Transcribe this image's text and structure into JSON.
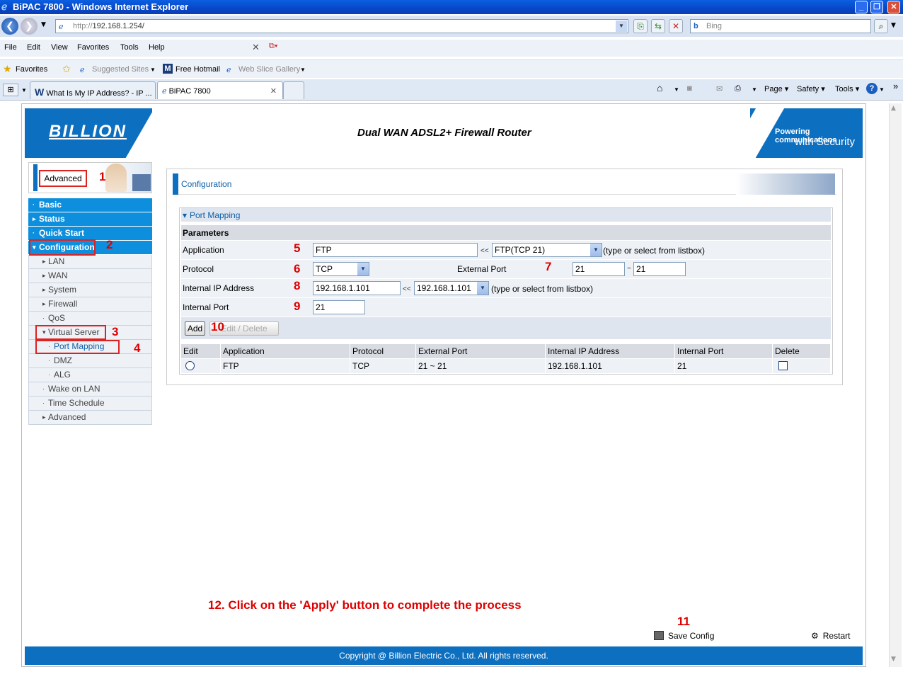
{
  "window": {
    "title": "BiPAC 7800 - Windows Internet Explorer"
  },
  "address": {
    "protocol": "http://",
    "host": "192.168.1.254/",
    "search_placeholder": "Bing"
  },
  "menubar": [
    "File",
    "Edit",
    "View",
    "Favorites",
    "Tools",
    "Help"
  ],
  "favbar": {
    "favorites": "Favorites",
    "suggested": "Suggested Sites",
    "hotmail": "Free Hotmail",
    "webslice": "Web Slice Gallery"
  },
  "tabs": [
    {
      "label": "What Is My IP Address? - IP ..."
    },
    {
      "label": "BiPAC 7800"
    }
  ],
  "commandbar": {
    "page": "Page",
    "safety": "Safety",
    "tools": "Tools"
  },
  "header": {
    "logo": "BILLION",
    "product": "Dual WAN ADSL2+ Firewall Router",
    "tagline1": "Powering communications",
    "tagline2": "with Security"
  },
  "sidebar": {
    "mode": "Advanced",
    "items": [
      {
        "label": "Basic",
        "marker": "·"
      },
      {
        "label": "Status",
        "marker": "▸"
      },
      {
        "label": "Quick Start",
        "marker": "·"
      },
      {
        "label": "Configuration",
        "marker": "▾"
      },
      {
        "label": "LAN",
        "marker": "▸"
      },
      {
        "label": "WAN",
        "marker": "▸"
      },
      {
        "label": "System",
        "marker": "▸"
      },
      {
        "label": "Firewall",
        "marker": "▸"
      },
      {
        "label": "QoS",
        "marker": "·"
      },
      {
        "label": "Virtual Server",
        "marker": "▾"
      },
      {
        "label": "Port Mapping",
        "marker": "·"
      },
      {
        "label": "DMZ",
        "marker": "·"
      },
      {
        "label": "ALG",
        "marker": "·"
      },
      {
        "label": "Wake on LAN",
        "marker": "·"
      },
      {
        "label": "Time Schedule",
        "marker": "·"
      },
      {
        "label": "Advanced",
        "marker": "▸"
      }
    ]
  },
  "main": {
    "title": "Configuration",
    "section": "Port Mapping",
    "parameters_label": "Parameters",
    "application": {
      "label": "Application",
      "value": "FTP",
      "select_value": "FTP(TCP 21)",
      "hint": "(type or select from listbox)"
    },
    "protocol": {
      "label": "Protocol",
      "value": "TCP"
    },
    "external_port": {
      "label": "External Port",
      "from": "21",
      "to": "21"
    },
    "internal_ip": {
      "label": "Internal IP Address",
      "value": "192.168.1.101",
      "select_value": "192.168.1.101",
      "hint": "(type or select from listbox)"
    },
    "internal_port": {
      "label": "Internal Port",
      "value": "21"
    },
    "arrows": "<<",
    "tilde": "~",
    "add_button": "Add",
    "edit_delete_button": "Edit / Delete",
    "table": {
      "headers": [
        "Edit",
        "Application",
        "Protocol",
        "External Port",
        "Internal IP Address",
        "Internal Port",
        "Delete"
      ],
      "rows": [
        {
          "application": "FTP",
          "protocol": "TCP",
          "external_port": "21 ~ 21",
          "internal_ip": "192.168.1.101",
          "internal_port": "21"
        }
      ]
    }
  },
  "annotations": {
    "n1": "1",
    "n2": "2",
    "n3": "3",
    "n4": "4",
    "n5": "5",
    "n6": "6",
    "n7": "7",
    "n8": "8",
    "n9": "9",
    "n10": "10",
    "n11": "11",
    "instruction": "12. Click on the 'Apply' button to complete the process"
  },
  "actions": {
    "save": "Save Config",
    "restart": "Restart"
  },
  "footer": "Copyright @ Billion Electric Co., Ltd. All rights reserved.",
  "colors": {
    "brand_blue": "#0d6fbf",
    "menu_blue": "#0d8fde",
    "annotation_red": "#d22222"
  }
}
